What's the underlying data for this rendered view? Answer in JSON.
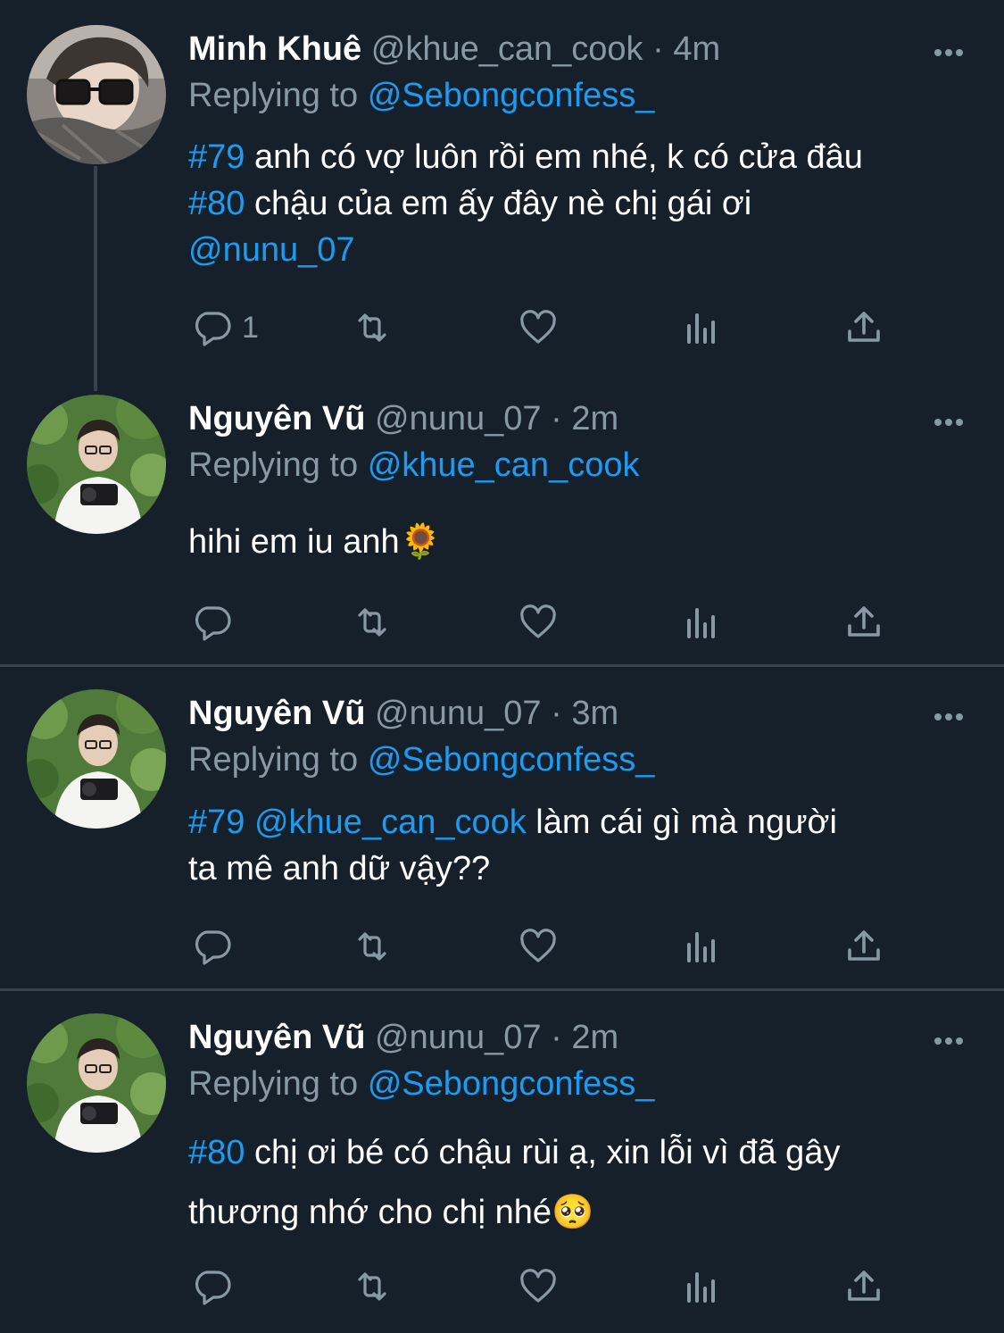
{
  "tweets": [
    {
      "name": "Minh Khuê",
      "handle": "@khue_can_cook",
      "time": "4m",
      "replying_label": "Replying to",
      "replying_to": "@Sebongconfess_",
      "lines": [
        [
          {
            "t": "#79",
            "link": true
          },
          {
            "t": " anh có vợ luôn rồi em nhé, k có cửa đâu",
            "link": false
          }
        ],
        [
          {
            "t": "#80",
            "link": true
          },
          {
            "t": " chậu của em ấy đây nè chị gái ơi",
            "link": false
          }
        ],
        [
          {
            "t": "@nunu_07",
            "link": true
          }
        ]
      ],
      "reply_count": "1"
    },
    {
      "name": "Nguyên Vũ",
      "handle": "@nunu_07",
      "time": "2m",
      "replying_label": "Replying to",
      "replying_to": "@khue_can_cook",
      "lines": [
        [
          {
            "t": "hihi em iu anh",
            "link": false
          },
          {
            "t": "🌻",
            "link": false,
            "emoji": true
          }
        ]
      ],
      "reply_count": ""
    },
    {
      "name": "Nguyên Vũ",
      "handle": "@nunu_07",
      "time": "3m",
      "replying_label": "Replying to",
      "replying_to": "@Sebongconfess_",
      "lines": [
        [
          {
            "t": "#79",
            "link": true
          },
          {
            "t": " ",
            "link": false
          },
          {
            "t": "@khue_can_cook",
            "link": true
          },
          {
            "t": " làm cái gì mà người",
            "link": false
          }
        ],
        [
          {
            "t": "ta mê anh dữ vậy??",
            "link": false
          }
        ]
      ],
      "reply_count": ""
    },
    {
      "name": "Nguyên Vũ",
      "handle": "@nunu_07",
      "time": "2m",
      "replying_label": "Replying to",
      "replying_to": "@Sebongconfess_",
      "lines": [
        [
          {
            "t": "#80",
            "link": true
          },
          {
            "t": " chị ơi bé có chậu rùi ạ, xin lỗi vì đã gây",
            "link": false
          }
        ],
        [
          {
            "t": "thương nhớ cho chị nhé",
            "link": false
          },
          {
            "t": "🥺",
            "link": false,
            "emoji": true
          }
        ]
      ],
      "reply_count": ""
    }
  ],
  "icons": {
    "reply": "reply-icon",
    "retweet": "retweet-icon",
    "like": "heart-icon",
    "views": "views-icon",
    "share": "share-icon",
    "more": "more-icon"
  },
  "colors": {
    "background": "#15202b",
    "link": "#1d9bf0",
    "muted": "#8899a6",
    "divider": "#38444d"
  }
}
